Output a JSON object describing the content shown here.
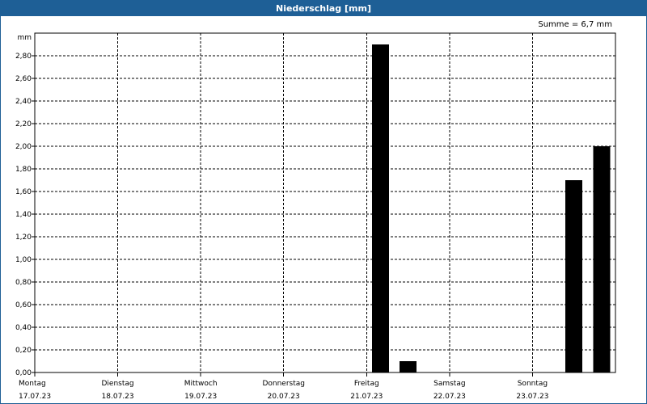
{
  "chart_data": {
    "type": "bar",
    "title": "Niederschlag [mm]",
    "ylabel": "mm",
    "summary": "Summe = 6,7 mm",
    "ylim": [
      0,
      3.0
    ],
    "ytick_values": [
      0,
      0.2,
      0.4,
      0.6,
      0.8,
      1.0,
      1.2,
      1.4,
      1.6,
      1.8,
      2.0,
      2.2,
      2.4,
      2.6,
      2.8
    ],
    "ytick_labels": [
      "0,00",
      "0,20",
      "0,40",
      "0,60",
      "0,80",
      "1,00",
      "1,20",
      "1,40",
      "1,60",
      "1,80",
      "2,00",
      "2,20",
      "2,40",
      "2,60",
      "2,80"
    ],
    "xlim": [
      "2023-07-17",
      "2023-07-24"
    ],
    "days": [
      {
        "date": "2023-07-17",
        "weekday": "Montag",
        "label": "17.07.23"
      },
      {
        "date": "2023-07-18",
        "weekday": "Dienstag",
        "label": "18.07.23"
      },
      {
        "date": "2023-07-19",
        "weekday": "Mittwoch",
        "label": "19.07.23"
      },
      {
        "date": "2023-07-20",
        "weekday": "Donnerstag",
        "label": "20.07.23"
      },
      {
        "date": "2023-07-21",
        "weekday": "Freitag",
        "label": "21.07.23"
      },
      {
        "date": "2023-07-22",
        "weekday": "Samstag",
        "label": "22.07.23"
      },
      {
        "date": "2023-07-23",
        "weekday": "Sonntag",
        "label": "23.07.23"
      }
    ],
    "bars": [
      {
        "date": "2023-07-21",
        "period": 0,
        "value": 2.9
      },
      {
        "date": "2023-07-21",
        "period": 1,
        "value": 0.1
      },
      {
        "date": "2023-07-23",
        "period": 1,
        "value": 1.7
      },
      {
        "date": "2023-07-23",
        "period": 2,
        "value": 2.0
      }
    ],
    "bar_color": "#000000",
    "grid": true
  }
}
